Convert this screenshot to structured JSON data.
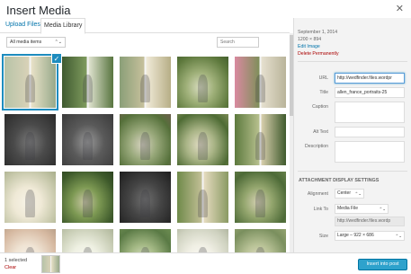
{
  "modal": {
    "title": "Insert Media",
    "close_glyph": "✕"
  },
  "tabs": [
    {
      "label": "Upload Files"
    },
    {
      "label": "Media Library"
    }
  ],
  "toolbar": {
    "filter_value": "All media items",
    "filter_arrow": "⌃⌄",
    "search_placeholder": "Search"
  },
  "grid": {
    "selected_index": 0,
    "checkmark_glyph": "✓",
    "thumbs": [
      {
        "kind": "diptych",
        "colors": [
          "#b7c3a7",
          "#d9d2b8",
          "#e9e2c8",
          "#97a98a"
        ]
      },
      {
        "kind": "diptych",
        "colors": [
          "#3f5a30",
          "#7f9b5e",
          "#e0e3d0",
          "#58753f"
        ]
      },
      {
        "kind": "diptych",
        "colors": [
          "#8b9f78",
          "#c6c09c",
          "#f1ebd9",
          "#b7ae86"
        ]
      },
      {
        "kind": "single",
        "colors": [
          "#5f7a3e",
          "#9fb079",
          "#d8dcbf",
          "#44602d"
        ]
      },
      {
        "kind": "diptych",
        "colors": [
          "#d98aa0",
          "#7f8f5a",
          "#e6e0cf",
          "#b9b49a"
        ]
      },
      {
        "kind": "bw",
        "colors": [
          "#2a2a2a",
          "#7a7a7a",
          "#d6d6d6",
          "#4a4a4a"
        ]
      },
      {
        "kind": "bw",
        "colors": [
          "#3a3a3a",
          "#9a9a9a",
          "#e8e8e8",
          "#5a5a5a"
        ]
      },
      {
        "kind": "single",
        "colors": [
          "#55703a",
          "#98a87a",
          "#d7d3c0",
          "#6d5f4c"
        ]
      },
      {
        "kind": "single",
        "colors": [
          "#4e6b34",
          "#a9b486",
          "#e2ddc4",
          "#7b8a55"
        ]
      },
      {
        "kind": "diptych",
        "colors": [
          "#5d7a3e",
          "#b7c08e",
          "#d9d0ae",
          "#3f5a2d"
        ]
      },
      {
        "kind": "single",
        "colors": [
          "#c4c6a8",
          "#efe9d6",
          "#f7f3e7",
          "#a8ad8b"
        ]
      },
      {
        "kind": "single",
        "colors": [
          "#3e5a2b",
          "#7d9953",
          "#c9c7a4",
          "#2c4320"
        ]
      },
      {
        "kind": "bw",
        "colors": [
          "#1e1e1e",
          "#6e6e6e",
          "#cfcfcf",
          "#444444"
        ]
      },
      {
        "kind": "diptych",
        "colors": [
          "#6f8a4a",
          "#c2bf96",
          "#e6dcc0",
          "#8a9a63"
        ]
      },
      {
        "kind": "single",
        "colors": [
          "#4d6a37",
          "#94a66e",
          "#d4d0b2",
          "#66804a"
        ]
      },
      {
        "kind": "single",
        "colors": [
          "#d6b9a1",
          "#efe3d3",
          "#f8f3ea",
          "#b9a089"
        ]
      },
      {
        "kind": "single",
        "colors": [
          "#c8cdb5",
          "#eef0e2",
          "#fafaf2",
          "#aeb59a"
        ]
      },
      {
        "kind": "single",
        "colors": [
          "#5a7a45",
          "#a3b884",
          "#dbe2c6",
          "#6d8d52"
        ]
      },
      {
        "kind": "single",
        "colors": [
          "#cfd2c0",
          "#f0efe4",
          "#fbfaf4",
          "#b1b6a0"
        ]
      },
      {
        "kind": "single",
        "colors": [
          "#7a8f5e",
          "#b8c296",
          "#e1ddc4",
          "#93a36f"
        ]
      }
    ]
  },
  "details": {
    "date": "September 1, 2014",
    "dimensions": "1200 × 894",
    "edit_link": "Edit Image",
    "delete_link": "Delete Permanently",
    "fields": {
      "url_label": "URL",
      "url_value": "http://wedfinder.files.wordpr",
      "title_label": "Title",
      "title_value": "allen_france_portraits-25",
      "caption_label": "Caption",
      "caption_value": "",
      "alt_label": "Alt Text",
      "alt_value": "",
      "description_label": "Description",
      "description_value": ""
    }
  },
  "display_settings": {
    "heading": "ATTACHMENT DISPLAY SETTINGS",
    "alignment_label": "Alignment",
    "alignment_value": "Center",
    "link_to_label": "Link To",
    "link_to_value": "Media File",
    "link_url_value": "http://wedfinder.files.wordp",
    "size_label": "Size",
    "size_value": "Large – 922 × 686"
  },
  "footer": {
    "selected_count": "1 selected",
    "clear_label": "Clear",
    "insert_button": "Insert into post"
  }
}
